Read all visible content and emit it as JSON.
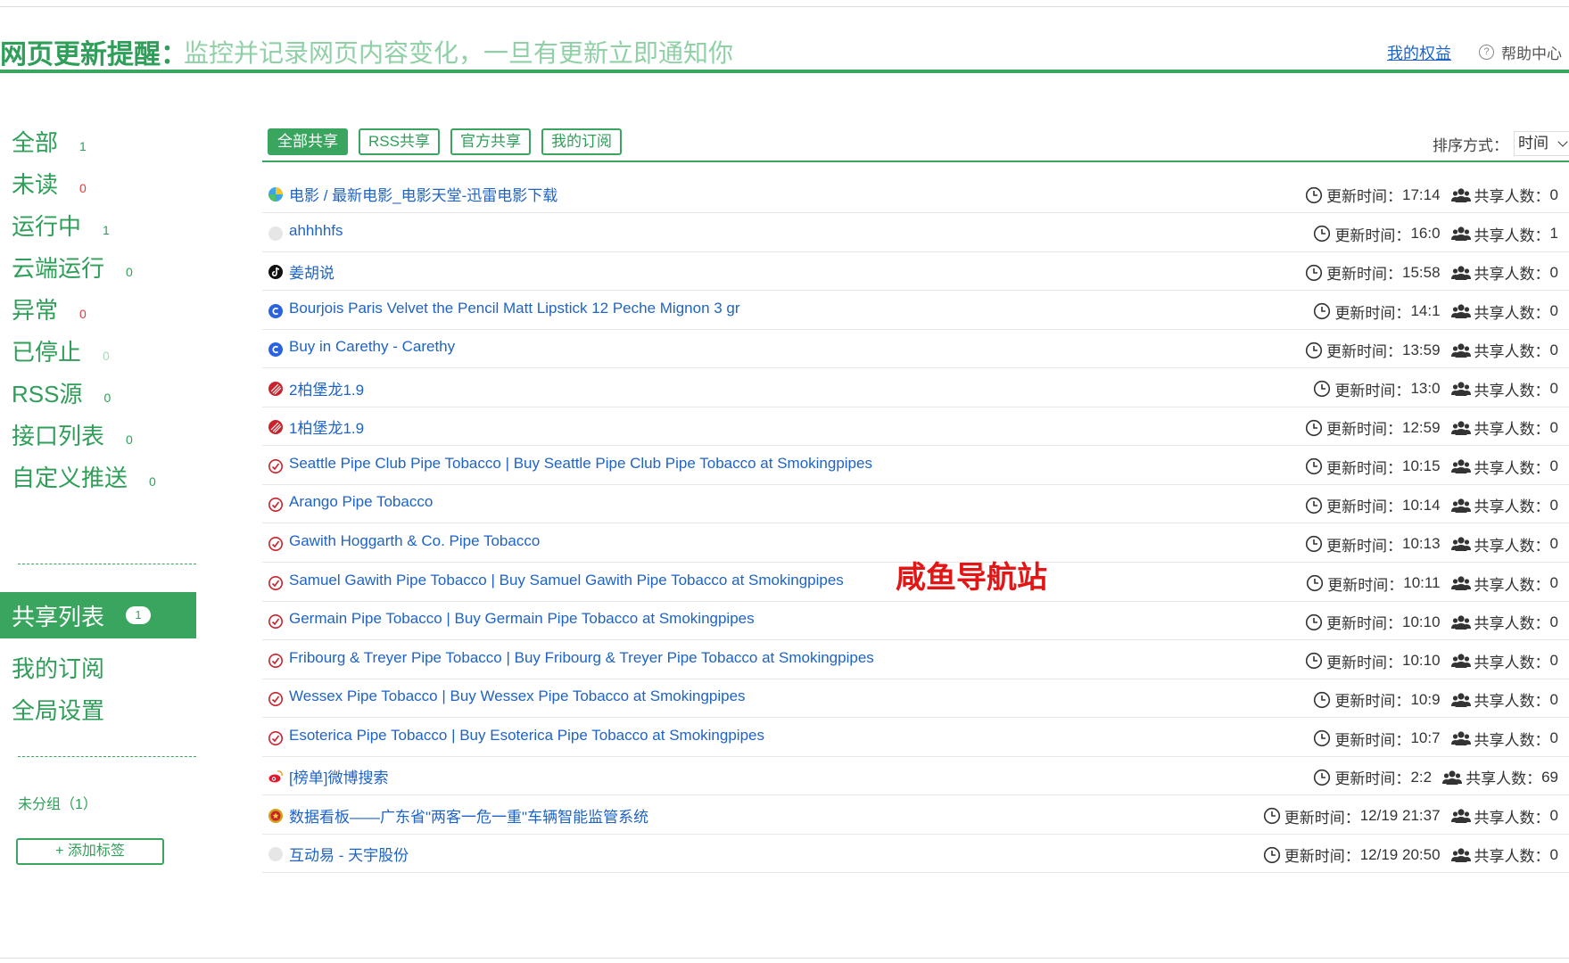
{
  "header": {
    "title": "网页更新提醒：",
    "subtitle": "监控并记录网页内容变化，一旦有更新立即通知你",
    "my_rights": "我的权益",
    "help_center": "帮助中心",
    "help_icon": "question-circle-icon"
  },
  "sidebar": {
    "items": [
      {
        "label": "全部",
        "count": "1",
        "count_color": "green"
      },
      {
        "label": "未读",
        "count": "0",
        "count_color": "red"
      },
      {
        "label": "运行中",
        "count": "1",
        "count_color": "green"
      },
      {
        "label": "云端运行",
        "count": "0",
        "count_color": "green"
      },
      {
        "label": "异常",
        "count": "0",
        "count_color": "red"
      },
      {
        "label": "已停止",
        "count": "0",
        "count_color": "light"
      },
      {
        "label": "RSS源",
        "count": "0",
        "count_color": "green"
      },
      {
        "label": "接口列表",
        "count": "0",
        "count_color": "green"
      },
      {
        "label": "自定义推送",
        "count": "0",
        "count_color": "green"
      }
    ],
    "shared_list": {
      "label": "共享列表",
      "badge": "1"
    },
    "my_subscriptions": "我的订阅",
    "global_settings": "全局设置",
    "ungrouped": "未分组（1）",
    "add_tag": "+ 添加标签"
  },
  "tabs": [
    {
      "label": "全部共享",
      "active": true
    },
    {
      "label": "RSS共享",
      "active": false
    },
    {
      "label": "官方共享",
      "active": false
    },
    {
      "label": "我的订阅",
      "active": false
    }
  ],
  "sort": {
    "label": "排序方式：",
    "value": "时间"
  },
  "meta_labels": {
    "update_time": "更新时间：",
    "share_count": "共享人数："
  },
  "rows": [
    {
      "title": "电影 / 最新电影_电影天堂-迅雷电影下载",
      "time": "17:14",
      "shares": "0",
      "icon": "globe-color-icon"
    },
    {
      "title": "ahhhhfs",
      "time": "16:0",
      "shares": "1",
      "icon": "blank-circle-icon"
    },
    {
      "title": "姜胡说",
      "time": "15:58",
      "shares": "0",
      "icon": "tiktok-icon"
    },
    {
      "title": "Bourjois Paris Velvet the Pencil Matt Lipstick 12 Peche Mignon 3 gr",
      "time": "14:1",
      "shares": "0",
      "icon": "blue-c-icon"
    },
    {
      "title": "Buy in Carethy - Carethy",
      "time": "13:59",
      "shares": "0",
      "icon": "blue-c-icon"
    },
    {
      "title": "2柏堡龙1.9",
      "time": "13:0",
      "shares": "0",
      "icon": "red-stripe-icon"
    },
    {
      "title": "1柏堡龙1.9",
      "time": "12:59",
      "shares": "0",
      "icon": "red-stripe-icon"
    },
    {
      "title": "Seattle Pipe Club Pipe Tobacco | Buy Seattle Pipe Club Pipe Tobacco at Smokingpipes",
      "time": "10:15",
      "shares": "0",
      "icon": "red-check-icon"
    },
    {
      "title": "Arango Pipe Tobacco",
      "time": "10:14",
      "shares": "0",
      "icon": "red-check-icon"
    },
    {
      "title": "Gawith Hoggarth & Co. Pipe Tobacco",
      "time": "10:13",
      "shares": "0",
      "icon": "red-check-icon"
    },
    {
      "title": "Samuel Gawith Pipe Tobacco | Buy Samuel Gawith Pipe Tobacco at Smokingpipes",
      "time": "10:11",
      "shares": "0",
      "icon": "red-check-icon"
    },
    {
      "title": "Germain Pipe Tobacco | Buy Germain Pipe Tobacco at Smokingpipes",
      "time": "10:10",
      "shares": "0",
      "icon": "red-check-icon"
    },
    {
      "title": "Fribourg & Treyer Pipe Tobacco | Buy Fribourg & Treyer Pipe Tobacco at Smokingpipes",
      "time": "10:10",
      "shares": "0",
      "icon": "red-check-icon"
    },
    {
      "title": "Wessex Pipe Tobacco | Buy Wessex Pipe Tobacco at Smokingpipes",
      "time": "10:9",
      "shares": "0",
      "icon": "red-check-icon"
    },
    {
      "title": "Esoterica Pipe Tobacco | Buy Esoterica Pipe Tobacco at Smokingpipes",
      "time": "10:7",
      "shares": "0",
      "icon": "red-check-icon"
    },
    {
      "title": "[榜单]微博搜索",
      "time": "2:2",
      "shares": "69",
      "icon": "weibo-icon"
    },
    {
      "title": "数据看板——广东省\"两客一危一重\"车辆智能监管系统",
      "time": "12/19 21:37",
      "shares": "0",
      "icon": "emblem-icon"
    },
    {
      "title": "互动易 - 天宇股份",
      "time": "12/19 20:50",
      "shares": "0",
      "icon": "blank-circle-icon"
    }
  ],
  "watermark": "咸鱼导航站",
  "colors": {
    "brand_green": "#3aa55e",
    "link_blue": "#1e63c6",
    "alert_red": "#e23b3b"
  }
}
